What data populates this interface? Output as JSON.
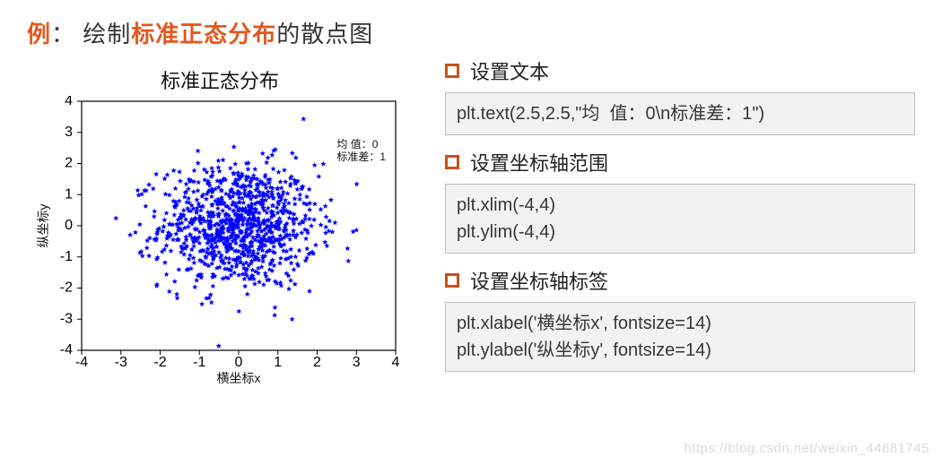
{
  "title": {
    "ex": "例",
    "colon": "：",
    "pre": "绘制",
    "highlight": "标准正态分布",
    "post": "的散点图"
  },
  "sections": [
    {
      "head": "设置文本",
      "code": "plt.text(2.5,2.5,\"均  值：0\\n标准差：1\")"
    },
    {
      "head": "设置坐标轴范围",
      "code": "plt.xlim(-4,4)\nplt.ylim(-4,4)"
    },
    {
      "head": "设置坐标轴标签",
      "code": "plt.xlabel('横坐标x', fontsize=14)\nplt.ylabel('纵坐标y', fontsize=14)"
    }
  ],
  "watermark": "https://blog.csdn.net/weixin_44681745",
  "chart_data": {
    "type": "scatter",
    "title": "标准正态分布",
    "xlabel": "横坐标x",
    "ylabel": "纵坐标y",
    "xlim": [
      -4,
      4
    ],
    "ylim": [
      -4,
      4
    ],
    "xticks": [
      -4,
      -3,
      -2,
      -1,
      0,
      1,
      2,
      3,
      4
    ],
    "yticks": [
      -4,
      -3,
      -2,
      -1,
      0,
      1,
      2,
      3,
      4
    ],
    "n_points": 1000,
    "mean": 0,
    "std": 1,
    "marker": "star",
    "color": "#0000ff",
    "annotation": {
      "x": 2.5,
      "y": 2.5,
      "text": "均  值：0\n标准差：1"
    }
  }
}
